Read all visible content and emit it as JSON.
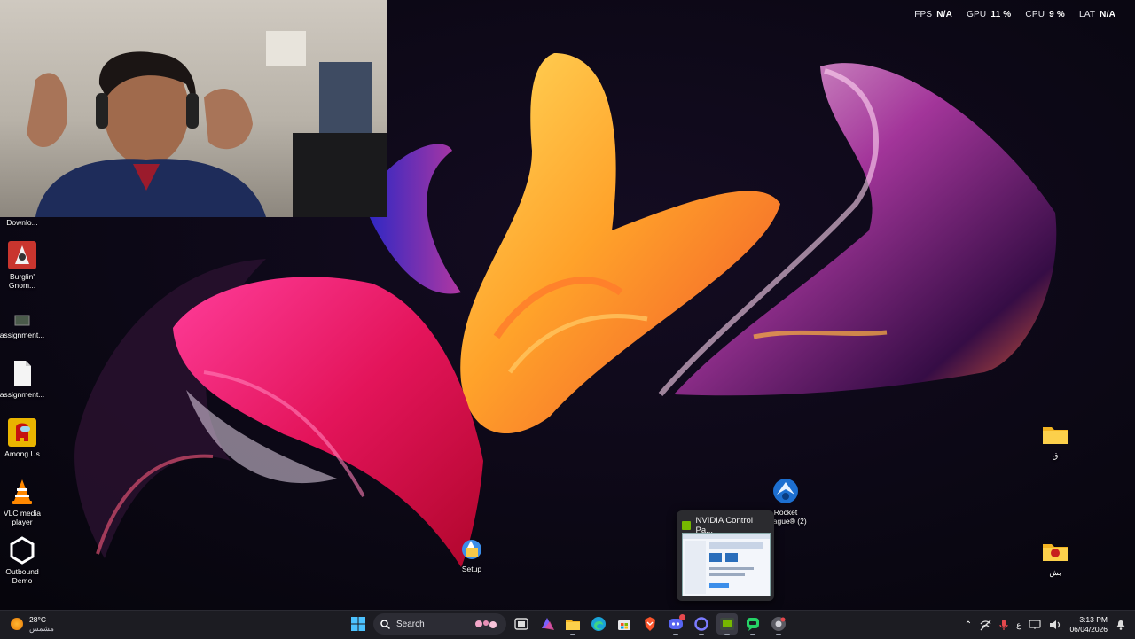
{
  "overlay": {
    "metrics": [
      {
        "label": "FPS",
        "value": "N/A"
      },
      {
        "label": "GPU",
        "value": "11 %"
      },
      {
        "label": "CPU",
        "value": "9 %"
      },
      {
        "label": "LAT",
        "value": "N/A"
      }
    ]
  },
  "desktop": {
    "left_icons": [
      {
        "name": "downloads",
        "label": "Downlo..."
      },
      {
        "name": "burglin-gnomes",
        "label": "Burglin' Gnom..."
      },
      {
        "name": "assignment-1",
        "label": "assignment..."
      },
      {
        "name": "assignment-2",
        "label": "assignment..."
      },
      {
        "name": "among-us",
        "label": "Among Us"
      },
      {
        "name": "vlc-media-player",
        "label": "VLC media player"
      },
      {
        "name": "outbound-demo",
        "label": "Outbound Demo"
      }
    ],
    "setup_label": "Setup",
    "rocket_label": "Rocket League® (2)",
    "right_folders": [
      {
        "label": "ق"
      },
      {
        "label": "بش"
      }
    ]
  },
  "preview": {
    "title": "NVIDIA Control Pa..."
  },
  "taskbar": {
    "weather": {
      "temp": "28°C",
      "condition": "مشمس"
    },
    "search_label": "Search",
    "pinned": [
      "file-explorer",
      "task-view",
      "m365-copilot",
      "folder",
      "edge",
      "store",
      "brave",
      "discord",
      "cortana",
      "nvidia-app",
      "whatsapp",
      "chrome"
    ],
    "lang": "ع",
    "time": "3:13 PM",
    "date": "06/04/2026"
  },
  "colors": {
    "nvidia": "#76b900",
    "taskbar": "#1c1c22",
    "accent": "#3b8eea"
  }
}
